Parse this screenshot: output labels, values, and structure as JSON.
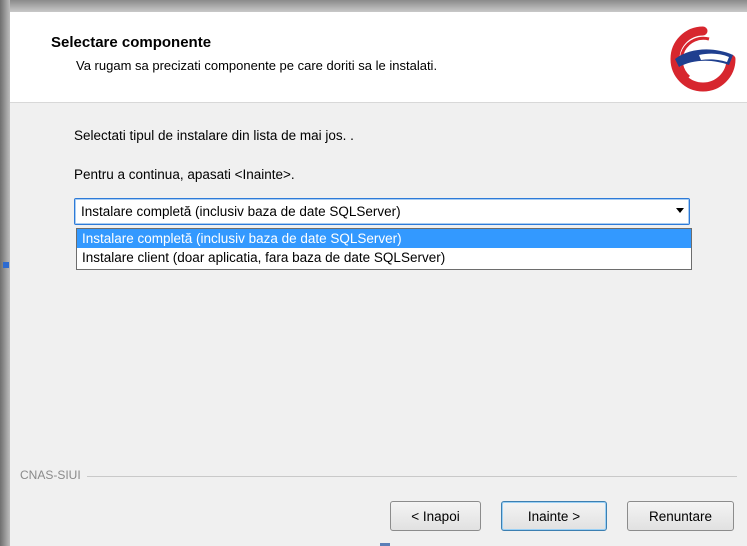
{
  "header": {
    "title": "Selectare componente",
    "subtitle": "Va rugam sa precizati componente pe care doriti sa le instalati.",
    "logo_icon": "cnas-logo-icon"
  },
  "content": {
    "instruction_line1": "Selectati tipul de instalare din lista de mai jos. .",
    "instruction_line2": "Pentru a continua, apasati <Inainte>."
  },
  "install_type": {
    "selected": "Instalare completă (inclusiv baza de date SQLServer)",
    "options": [
      "Instalare completă (inclusiv baza de date SQLServer)",
      "Instalare client (doar aplicatia, fara baza de date SQLServer)"
    ],
    "highlighted_index": 0
  },
  "footer": {
    "group_label": "CNAS-SIUI",
    "back_label": "< Inapoi",
    "next_label": "Inainte >",
    "cancel_label": "Renuntare"
  },
  "colors": {
    "highlight": "#3399ff",
    "focus_border": "#2d7ad8",
    "logo_red": "#d7262e",
    "logo_blue": "#1f3f8f"
  }
}
